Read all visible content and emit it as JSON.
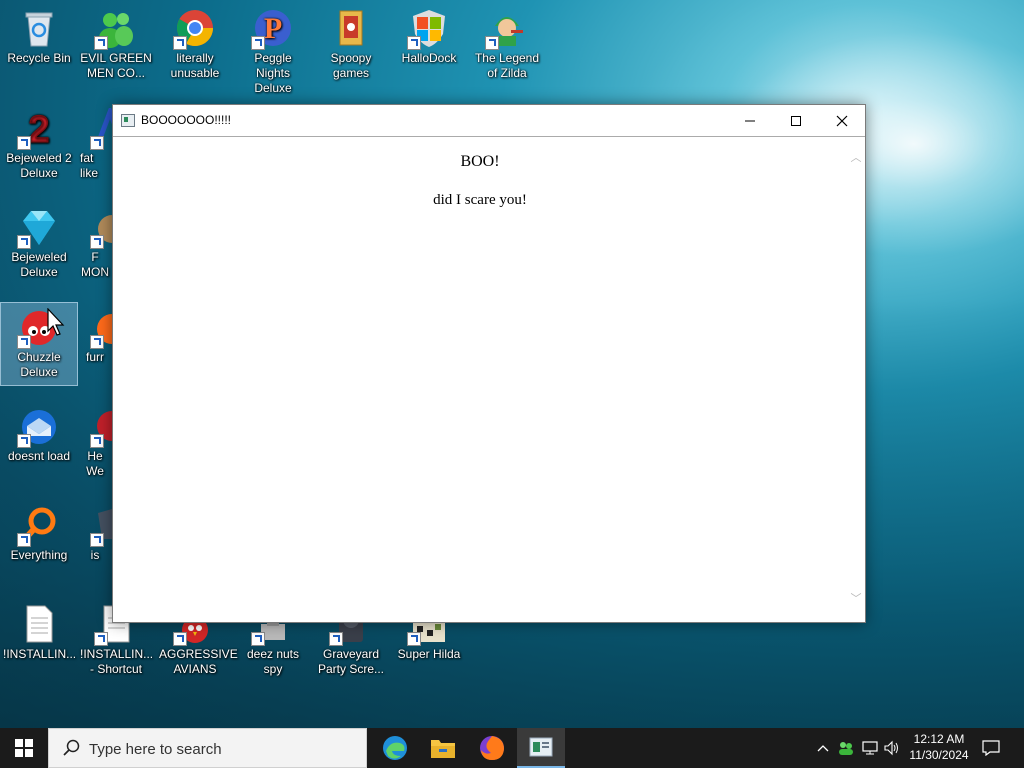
{
  "desktop": {
    "icons": [
      {
        "label": "Recycle Bin"
      },
      {
        "label": "EVIL GREEN MEN CO..."
      },
      {
        "label": "literally unusable"
      },
      {
        "label": "Peggle Nights Deluxe"
      },
      {
        "label": "Spoopy games"
      },
      {
        "label": "HalloDock"
      },
      {
        "label": "The Legend of Zilda"
      },
      {
        "label": "Bejeweled 2 Deluxe"
      },
      {
        "label": "fat like"
      },
      {
        "label": "Bejeweled Deluxe"
      },
      {
        "label": "F MON"
      },
      {
        "label": "Chuzzle Deluxe"
      },
      {
        "label": "furr"
      },
      {
        "label": "doesnt load"
      },
      {
        "label": "He We"
      },
      {
        "label": "Everything"
      },
      {
        "label": "is"
      },
      {
        "label": "!INSTALLIN..."
      },
      {
        "label": "!INSTALLIN... - Shortcut"
      },
      {
        "label": "AGGRESSIVE AVIANS"
      },
      {
        "label": "deez nuts spy"
      },
      {
        "label": "Graveyard Party Scre..."
      },
      {
        "label": "Super Hilda"
      }
    ]
  },
  "window": {
    "title": "BOOOOOOO!!!!!",
    "heading": "BOO!",
    "message": "did I scare you!"
  },
  "taskbar": {
    "search_placeholder": "Type here to search",
    "apps": [
      "edge-icon",
      "file-explorer-icon",
      "firefox-icon",
      "boo-app-icon"
    ],
    "time": "12:12 AM",
    "date": "11/30/2024"
  },
  "colors": {
    "taskbar_bg": "#1b1b1b",
    "accent": "#7ab7e8",
    "desktop_water": "#0c6d8c"
  }
}
